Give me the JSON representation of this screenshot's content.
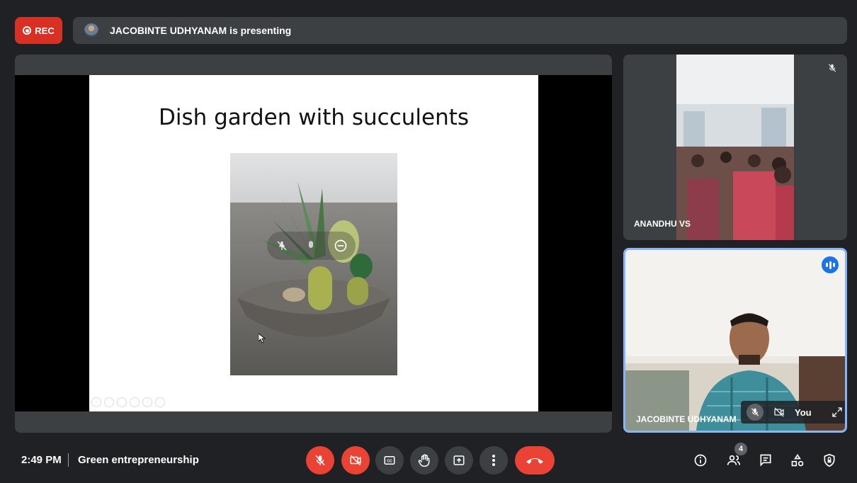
{
  "recording": {
    "label": "REC"
  },
  "presenting": {
    "text": "JACOBINTE UDHYANAM is presenting"
  },
  "slide": {
    "title": "Dish garden with succulents"
  },
  "participants": [
    {
      "name": "ANANDHU VS",
      "muted": true
    },
    {
      "name": "JACOBINTE UDHYANAM",
      "self_label": "You",
      "speaking": true
    }
  ],
  "meeting": {
    "time": "2:49 PM",
    "separator": "|",
    "title": "Green entrepreneurship"
  },
  "people_count": "4",
  "colors": {
    "accent": "#8ab4f8",
    "danger": "#ea4335",
    "surface": "#3c4043",
    "background": "#202124"
  },
  "icons": [
    "record-icon",
    "mic-off-icon",
    "camera-off-icon",
    "captions-icon",
    "raise-hand-icon",
    "present-icon",
    "more-icon",
    "hangup-icon",
    "info-icon",
    "people-icon",
    "chat-icon",
    "activities-icon",
    "host-controls-icon",
    "expand-icon",
    "speaking-icon",
    "pin-icon",
    "remove-icon"
  ]
}
